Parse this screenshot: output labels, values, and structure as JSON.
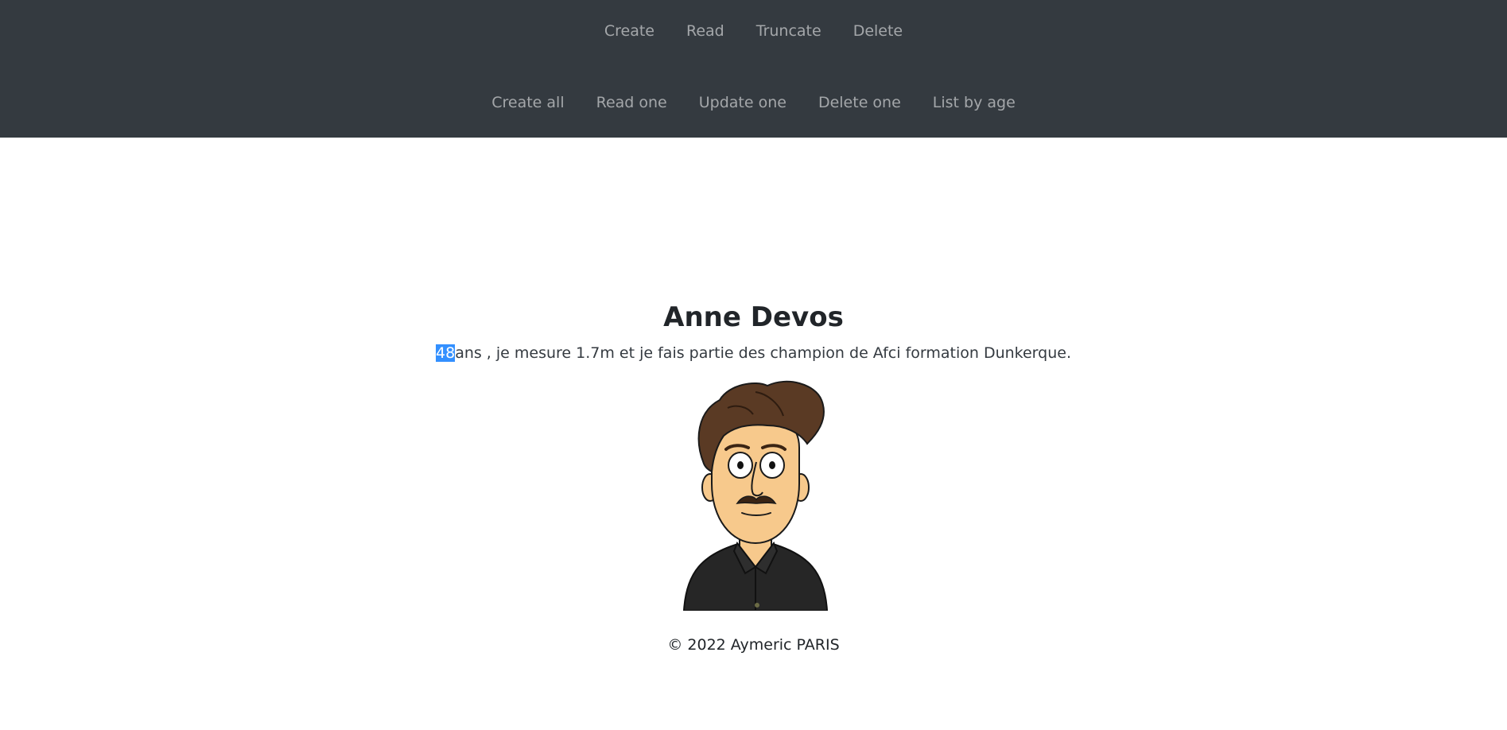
{
  "nav": {
    "row1": [
      "Create",
      "Read",
      "Truncate",
      "Delete"
    ],
    "row2": [
      "Create all",
      "Read one",
      "Update one",
      "Delete one",
      "List by age"
    ]
  },
  "profile": {
    "name": "Anne Devos",
    "age": "48",
    "bio_rest": "ans , je mesure 1.7m et je fais partie des champion de Afci formation Dunkerque.",
    "avatar_icon": "cartoon-man-avatar"
  },
  "footer": {
    "text": "© 2022 Aymeric PARIS"
  },
  "colors": {
    "navbar_bg": "#343a40",
    "selection": "#3390ff"
  }
}
